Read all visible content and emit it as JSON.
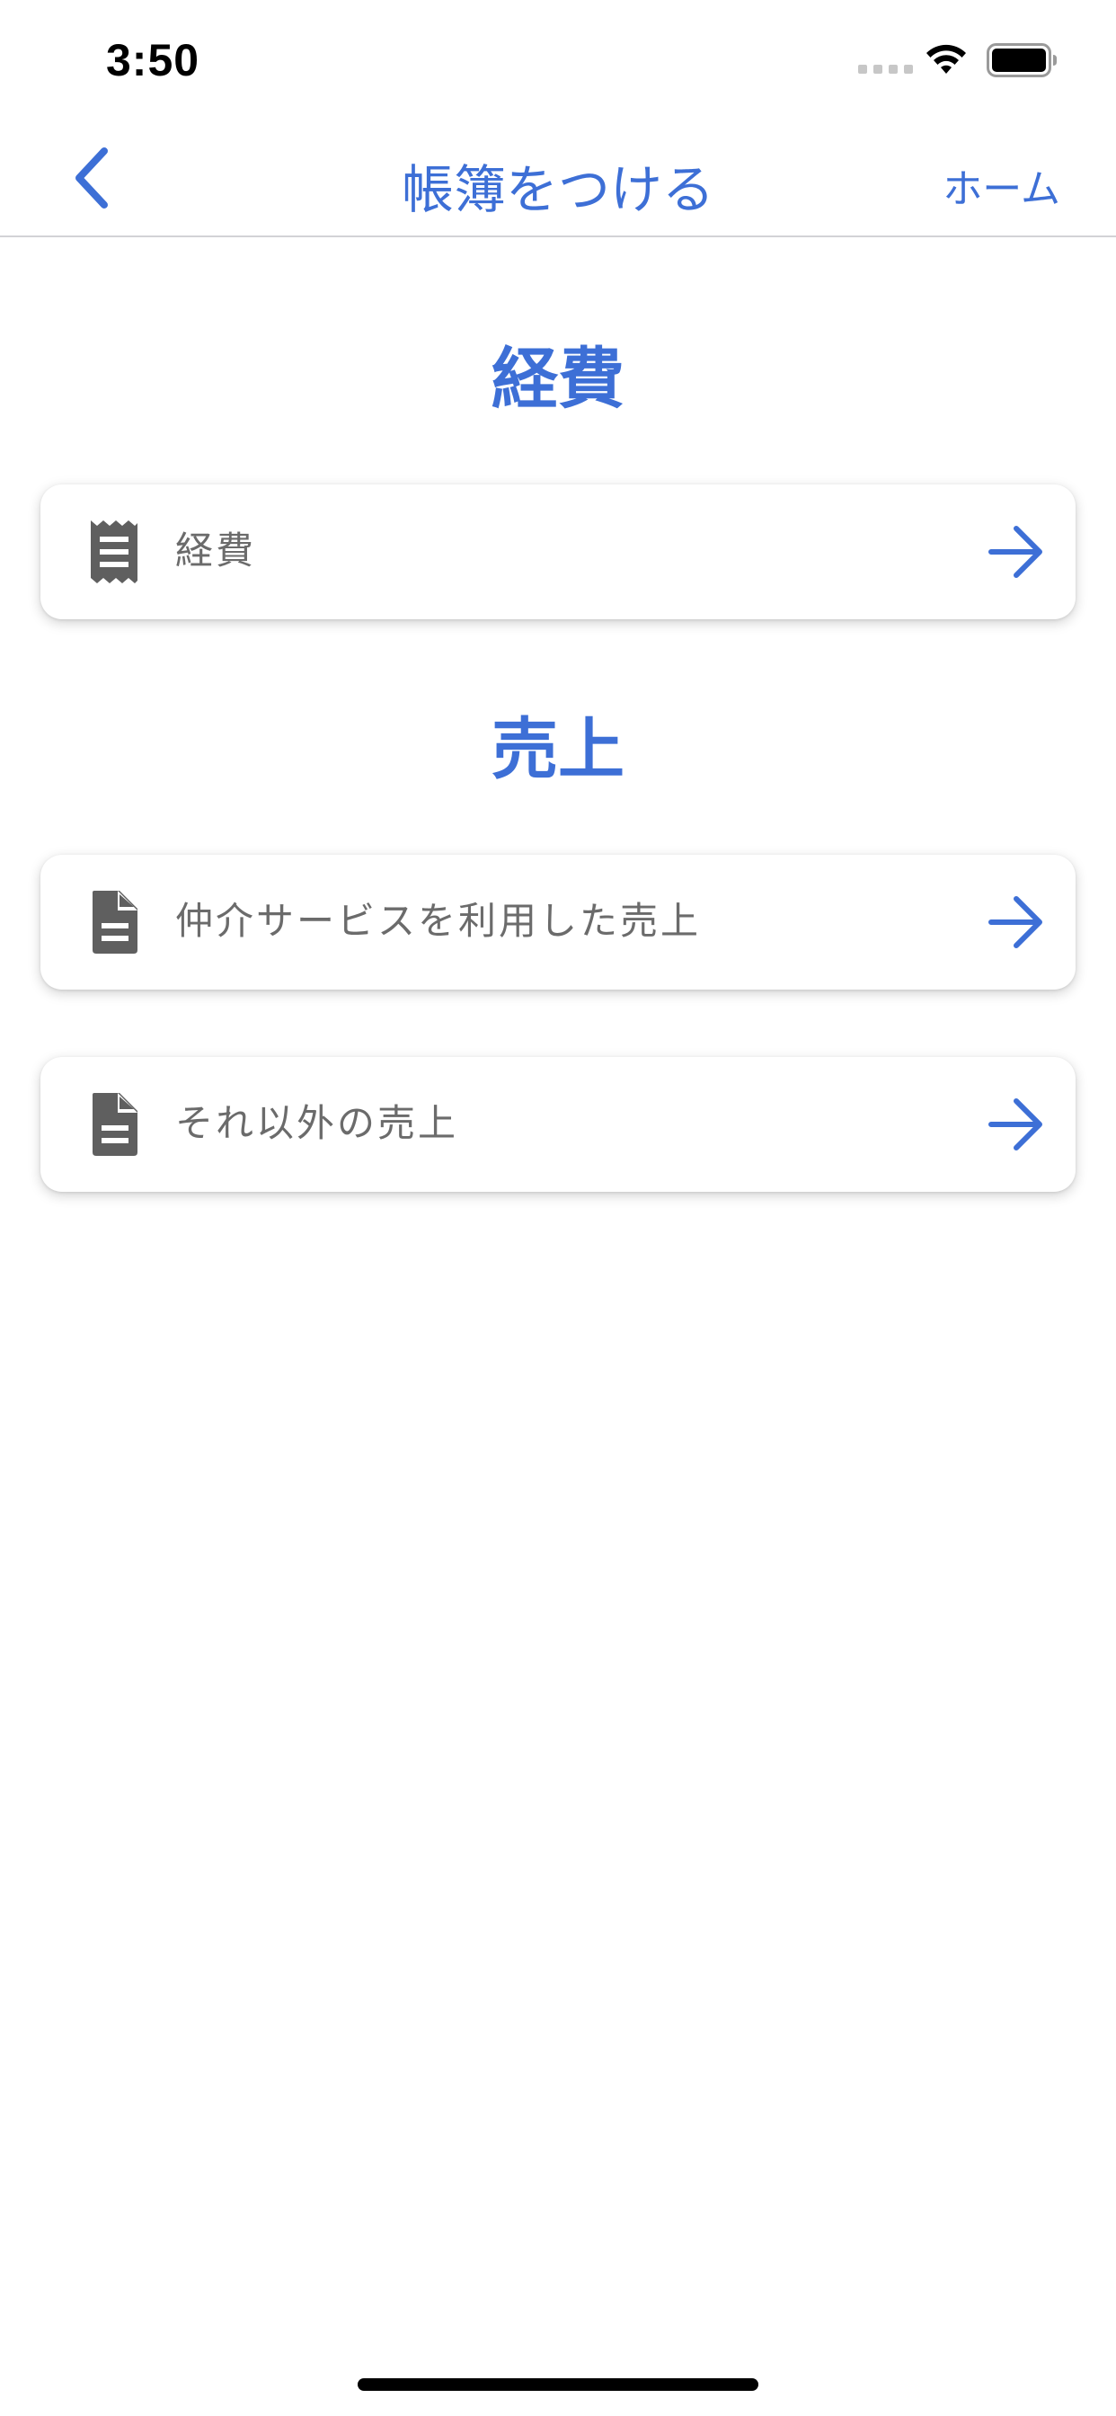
{
  "status_bar": {
    "time": "3:50"
  },
  "nav": {
    "title": "帳簿をつける",
    "home_label": "ホーム"
  },
  "sections": [
    {
      "title": "経費",
      "items": [
        {
          "label": "経費",
          "icon": "receipt-icon"
        }
      ]
    },
    {
      "title": "売上",
      "items": [
        {
          "label": "仲介サービスを利用した売上",
          "icon": "document-icon"
        },
        {
          "label": "それ以外の売上",
          "icon": "document-icon"
        }
      ]
    }
  ],
  "colors": {
    "accent": "#3d6fd6",
    "label": "#6b6b6b",
    "icon": "#5f5f5f"
  }
}
